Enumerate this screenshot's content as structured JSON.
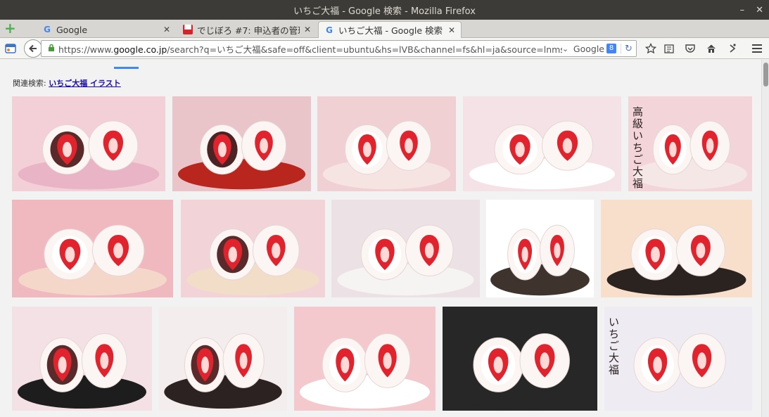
{
  "window": {
    "title": "いちご大福 - Google 検索 - Mozilla Firefox",
    "minimize": "–",
    "close": "✕"
  },
  "tabs": [
    {
      "label": "Google",
      "favicon": "G",
      "close": "✕"
    },
    {
      "label": "でじぼろ #7: 申込者の管理 -...",
      "favicon": "▀",
      "close": "✕"
    },
    {
      "label": "いちご大福 - Google 検索",
      "favicon": "G",
      "close": "✕"
    }
  ],
  "navbar": {
    "url_prefix": "https://www.",
    "url_domain": "google.co.jp",
    "url_rest": "/search?q=いちご大福&safe=off&client=ubuntu&hs=lVB&channel=fs&hl=ja&source=lnms&tbm=isch&sa=X&ve",
    "search_engine": "Google",
    "engine_badge": "8"
  },
  "related": {
    "prefix": "関連検索: ",
    "link": "いちご大福 イラスト"
  },
  "images": [
    {
      "bg": "#f3cfd8",
      "plate": "#e8b4c6",
      "fill": "#5a2a2a",
      "berry": true,
      "text": ""
    },
    {
      "bg": "#e9c4c9",
      "plate": "#b8261d",
      "fill": "#4b2323",
      "berry": true,
      "text": ""
    },
    {
      "bg": "#f1d0d3",
      "plate": "#f6e4e3",
      "fill": "#ffffff",
      "berry": true,
      "text": ""
    },
    {
      "bg": "#f5e2e6",
      "plate": "#ffffff",
      "fill": "#ffffff",
      "berry": true,
      "text": ""
    },
    {
      "bg": "#f3d5d9",
      "plate": "#f6e7e7",
      "fill": "#ffffff",
      "berry": true,
      "text": "高級 いちご大福"
    },
    {
      "bg": "#f0b8bf",
      "plate": "#f4d7c8",
      "fill": "#ffffff",
      "berry": true,
      "text": ""
    },
    {
      "bg": "#f2d3d7",
      "plate": "#f1ddc8",
      "fill": "#5a2a2a",
      "berry": true,
      "text": ""
    },
    {
      "bg": "#ece2e6",
      "plate": "#f6f3f3",
      "fill": "#ffffff",
      "berry": true,
      "text": ""
    },
    {
      "bg": "#ffffff",
      "plate": "#3e342d",
      "fill": "#ffffff",
      "berry": true,
      "text": ""
    },
    {
      "bg": "#f7dfcc",
      "plate": "#2a2320",
      "fill": "#ffffff",
      "berry": true,
      "text": ""
    },
    {
      "bg": "#f4e1e5",
      "plate": "#1d1d1d",
      "fill": "#5a2a2a",
      "berry": true,
      "text": ""
    },
    {
      "bg": "#f4eded",
      "plate": "#2b2221",
      "fill": "#5a2a2a",
      "berry": true,
      "text": ""
    },
    {
      "bg": "#f4c9cd",
      "plate": "#ffffff",
      "fill": "#ffffff",
      "berry": true,
      "text": ""
    },
    {
      "bg": "#272727",
      "plate": "#272727",
      "fill": "#ffffff",
      "berry": true,
      "text": ""
    },
    {
      "bg": "#eeecf2",
      "plate": "#eeecf2",
      "fill": "#ffffff",
      "berry": true,
      "text": "いちご大福"
    }
  ]
}
